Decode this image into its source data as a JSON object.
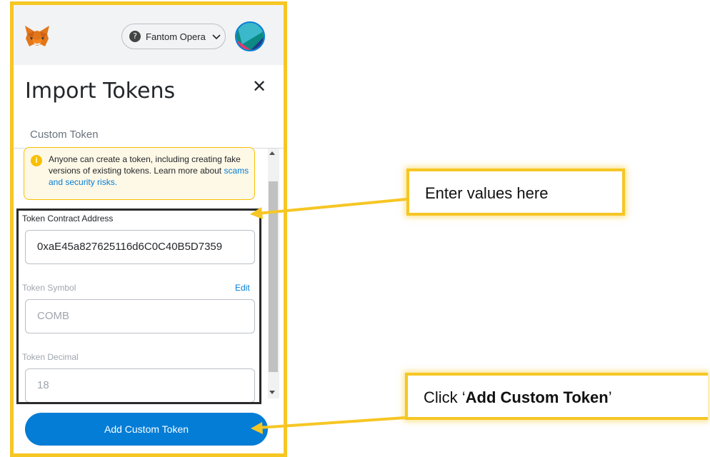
{
  "header": {
    "network_label": "Fantom Opera",
    "network_icon": "help-circle-icon"
  },
  "dialog": {
    "title": "Import Tokens",
    "close_glyph": "✕",
    "tab_label": "Custom Token"
  },
  "warning": {
    "text_before": "Anyone can create a token, including creating fake versions of existing tokens. Learn more about ",
    "link_text": "scams and security risks."
  },
  "fields": {
    "address_label": "Token Contract Address",
    "address_value": "0xaE45a827625116d6C0C40B5D7359",
    "symbol_label": "Token Symbol",
    "symbol_edit": "Edit",
    "symbol_value": "COMB",
    "decimal_label": "Token Decimal",
    "decimal_value": "18"
  },
  "add_button_label": "Add Custom Token",
  "callouts": {
    "values": "Enter values here",
    "click_prefix": "Click ‘",
    "click_bold": "Add Custom Token",
    "click_suffix": "’"
  },
  "colors": {
    "accent": "#037dd6",
    "highlight": "#f6c624",
    "warning_bg": "#fef8e7"
  }
}
